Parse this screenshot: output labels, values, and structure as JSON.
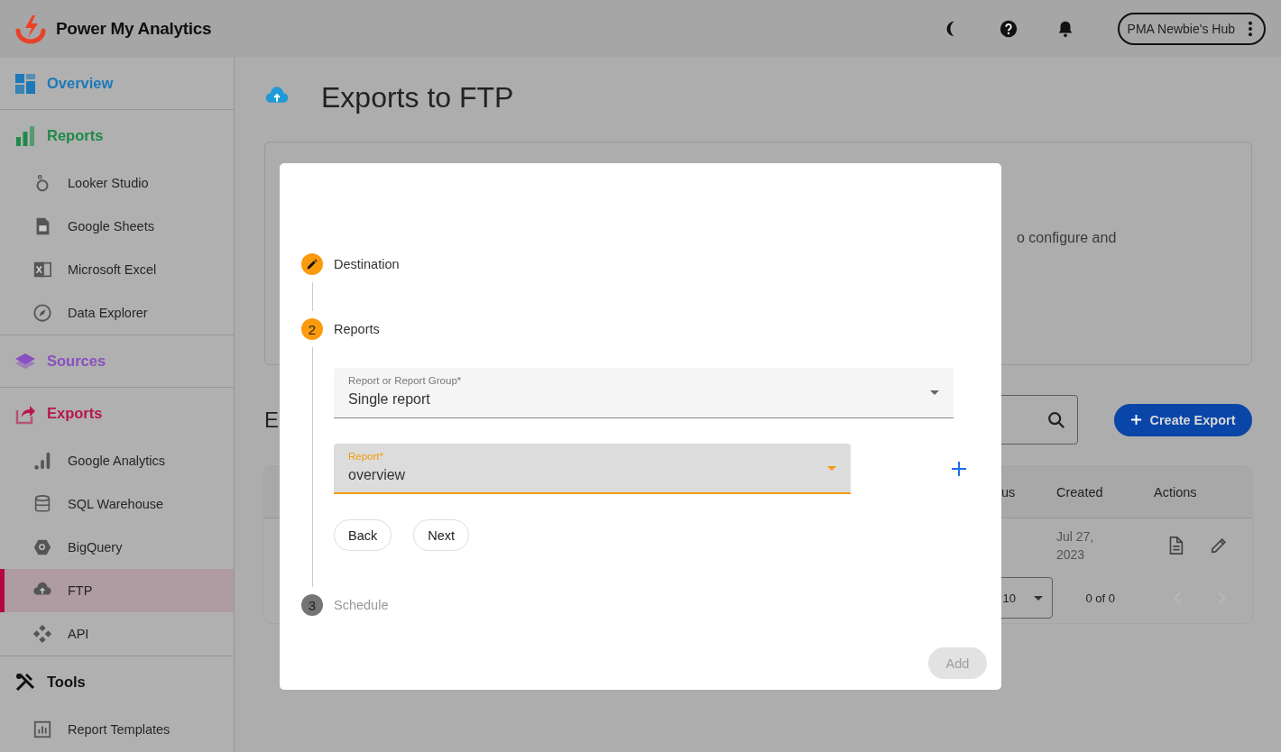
{
  "app": {
    "name": "Power My Analytics"
  },
  "header": {
    "account": "PMA Newbie's Hub"
  },
  "sidebar": {
    "sections": [
      {
        "label": "Overview",
        "color": "#1c78b8"
      },
      {
        "label": "Reports",
        "color": "#1e8a47",
        "items": [
          {
            "label": "Looker Studio",
            "selected": false
          },
          {
            "label": "Google Sheets",
            "selected": false
          },
          {
            "label": "Microsoft Excel",
            "selected": false
          },
          {
            "label": "Data Explorer",
            "selected": false
          }
        ]
      },
      {
        "label": "Sources",
        "color": "#8a4fc0"
      },
      {
        "label": "Exports",
        "color": "#b8174b",
        "items": [
          {
            "label": "Google Analytics",
            "selected": false
          },
          {
            "label": "SQL Warehouse",
            "selected": false
          },
          {
            "label": "BigQuery",
            "selected": false
          },
          {
            "label": "FTP",
            "selected": true
          },
          {
            "label": "API",
            "selected": false
          }
        ]
      },
      {
        "label": "Tools",
        "color": "#111111",
        "items": [
          {
            "label": "Report Templates",
            "selected": false
          }
        ]
      }
    ]
  },
  "page": {
    "title": "Exports to FTP",
    "intro_fragment": "o configure and",
    "section_heading": "E",
    "create_button": "Create Export",
    "table": {
      "columns": [
        "us",
        "Created",
        "Actions"
      ],
      "rows": [
        {
          "created": "Jul 27, 2023"
        }
      ]
    },
    "pagination": {
      "page_size": "10",
      "range": "0 of 0"
    }
  },
  "dialog": {
    "steps": [
      {
        "label": "Destination",
        "kind": "edited"
      },
      {
        "label": "Reports",
        "number": "2",
        "kind": "active"
      },
      {
        "label": "Schedule",
        "number": "3",
        "kind": "pending"
      }
    ],
    "fields": [
      {
        "label": "Report or Report Group*",
        "value": "Single report",
        "focused": false,
        "addable": false
      },
      {
        "label": "Report*",
        "value": "overview",
        "focused": true,
        "addable": true
      }
    ],
    "buttons": [
      "Back",
      "Next"
    ],
    "actions": [
      {
        "label": "Add",
        "disabled": true
      }
    ]
  }
}
